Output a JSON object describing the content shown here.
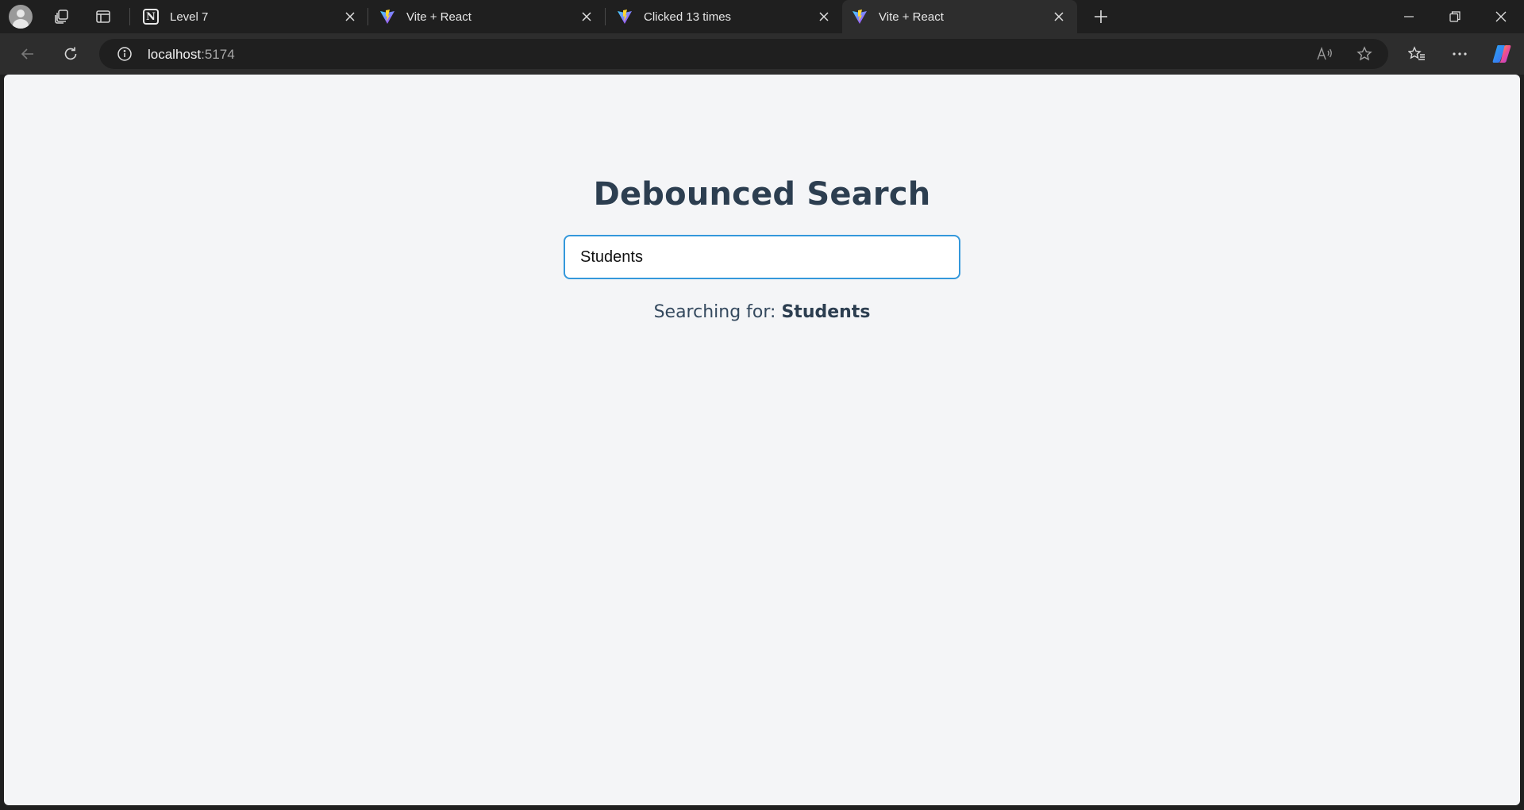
{
  "browser": {
    "tabs": [
      {
        "title": "Level 7",
        "icon": "notion-icon",
        "active": false
      },
      {
        "title": "Vite + React",
        "icon": "vite-icon",
        "active": false
      },
      {
        "title": "Clicked 13 times",
        "icon": "vite-icon",
        "active": false
      },
      {
        "title": "Vite + React",
        "icon": "vite-icon",
        "active": true
      }
    ],
    "address": {
      "host": "localhost",
      "port": ":5174"
    }
  },
  "page": {
    "title": "Debounced Search",
    "search": {
      "value": "Students"
    },
    "status": {
      "prefix": "Searching for:",
      "term": "Students"
    }
  },
  "colors": {
    "heading": "#2c3e50",
    "input_border": "#3498db",
    "page_background": "#f4f5f7",
    "chrome_dark": "#1f1f1f",
    "toolbar": "#2d2d2d"
  }
}
